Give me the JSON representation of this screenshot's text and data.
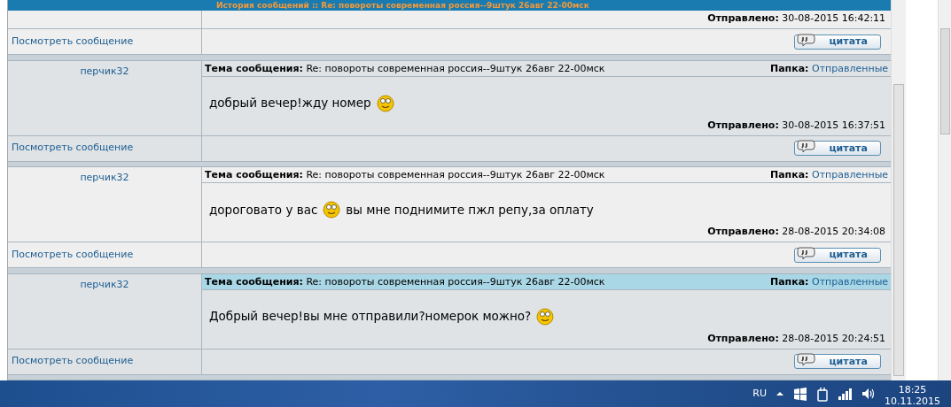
{
  "page_title": "История сообщений :: Re: повороты современная россия--9штук 26авг 22-00мск",
  "previous_message": {
    "sent_label": "Отправлено:",
    "sent": "30-08-2015 16:42:11",
    "view_link": "Посмотреть сообщение",
    "quote_button": "цитата"
  },
  "messages": [
    {
      "author": "перчик32",
      "subject_label": "Тема сообщения:",
      "subject": "Re: повороты современная россия--9штук 26авг 22-00мск",
      "folder_label": "Папка:",
      "folder": "Отправленные",
      "selected": false,
      "body": [
        {
          "kind": "text",
          "text": "добрый вечер!жду номер"
        },
        {
          "kind": "smiley"
        }
      ],
      "sent_label": "Отправлено:",
      "sent": "30-08-2015 16:37:51",
      "view_link": "Посмотреть сообщение",
      "quote_button": "цитата"
    },
    {
      "author": "перчик32",
      "subject_label": "Тема сообщения:",
      "subject": "Re: повороты современная россия--9штук 26авг 22-00мск",
      "folder_label": "Папка:",
      "folder": "Отправленные",
      "selected": false,
      "body": [
        {
          "kind": "text",
          "text": "дороговато у вас"
        },
        {
          "kind": "smiley"
        },
        {
          "kind": "text",
          "text": "вы мне поднимите пжл репу,за оплату"
        }
      ],
      "sent_label": "Отправлено:",
      "sent": "28-08-2015 20:34:08",
      "view_link": "Посмотреть сообщение",
      "quote_button": "цитата"
    },
    {
      "author": "перчик32",
      "subject_label": "Тема сообщения:",
      "subject": "Re: повороты современная россия--9штук 26авг 22-00мск",
      "folder_label": "Папка:",
      "folder": "Отправленные",
      "selected": true,
      "body": [
        {
          "kind": "text",
          "text": "Добрый вечер!вы мне отправили?номерок можно?"
        },
        {
          "kind": "smiley"
        }
      ],
      "sent_label": "Отправлено:",
      "sent": "28-08-2015 20:24:51",
      "view_link": "Посмотреть сообщение",
      "quote_button": "цитата"
    }
  ],
  "taskbar": {
    "language": "RU",
    "time": "18:25",
    "date": "10.11.2015"
  }
}
